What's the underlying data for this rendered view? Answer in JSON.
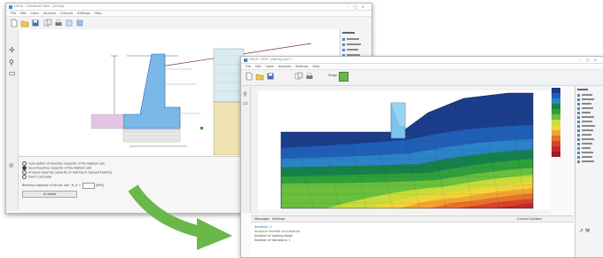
{
  "window_back": {
    "title": "GEO5 - Cantilever Wall - [Demo]",
    "menu": [
      "File",
      "Edit",
      "Input",
      "Analysis",
      "Outputs",
      "Settings",
      "Help"
    ],
    "right_panel_items": [
      "Frames",
      "Project",
      "Settings",
      "Geometry",
      "Material",
      "Profile",
      "Soils"
    ],
    "options": [
      "Calculation of bearing capacity of foundation soil",
      "Input bearing capacity of foundation soil",
      "Analyze bearing capacity of footing in Spread Footing",
      "Don't calculate"
    ],
    "field_label": "Bearing capacity of found. soil :",
    "field_value": "R_d =",
    "field_unit": "[kPa]",
    "details_button": "In detail"
  },
  "window_front": {
    "title": "GEO5 - FEM - [Demo].gm7 *",
    "menu": [
      "File",
      "Edit",
      "Input",
      "Analysis",
      "Settings",
      "Help"
    ],
    "stage_label": "Stage",
    "right_panel_items": [
      "Frames",
      "Project",
      "Settings",
      "Interfaces",
      "Soils",
      "Assign",
      "Free points",
      "Free lines",
      "Mesh generation",
      "Activation",
      "Assign",
      "Beams",
      "Point supports",
      "Line supports",
      "Geo-reinforcements",
      "Surcharge",
      "Water",
      "Analysis",
      "Monitors",
      "Graph"
    ],
    "bottom_tabs": [
      "Messages",
      "Settings"
    ],
    "bottom_right_label": "Current Solution",
    "messages": [
      "Iteration: 1",
      "Analysis finished successfully",
      "Number of loading steps",
      "Number of iterations: 1"
    ],
    "legend_values": [
      "0.00",
      "-5.00",
      "-10.00",
      "-15.00",
      "-20.00",
      "-25.00",
      "-30.00",
      "-35.00",
      "-40.00",
      "-45.00",
      "-50.00",
      "-55.00",
      "-60.00"
    ]
  },
  "colors": {
    "accent_green": "#6ab74a",
    "contour": [
      "#1b3d8a",
      "#1f5fb5",
      "#2b83c8",
      "#17804a",
      "#2f9f3a",
      "#6bbf3c",
      "#c9dc3a",
      "#f1d43a",
      "#f1a530",
      "#e6722a",
      "#d8432a",
      "#c4262b",
      "#9e1c26"
    ]
  }
}
